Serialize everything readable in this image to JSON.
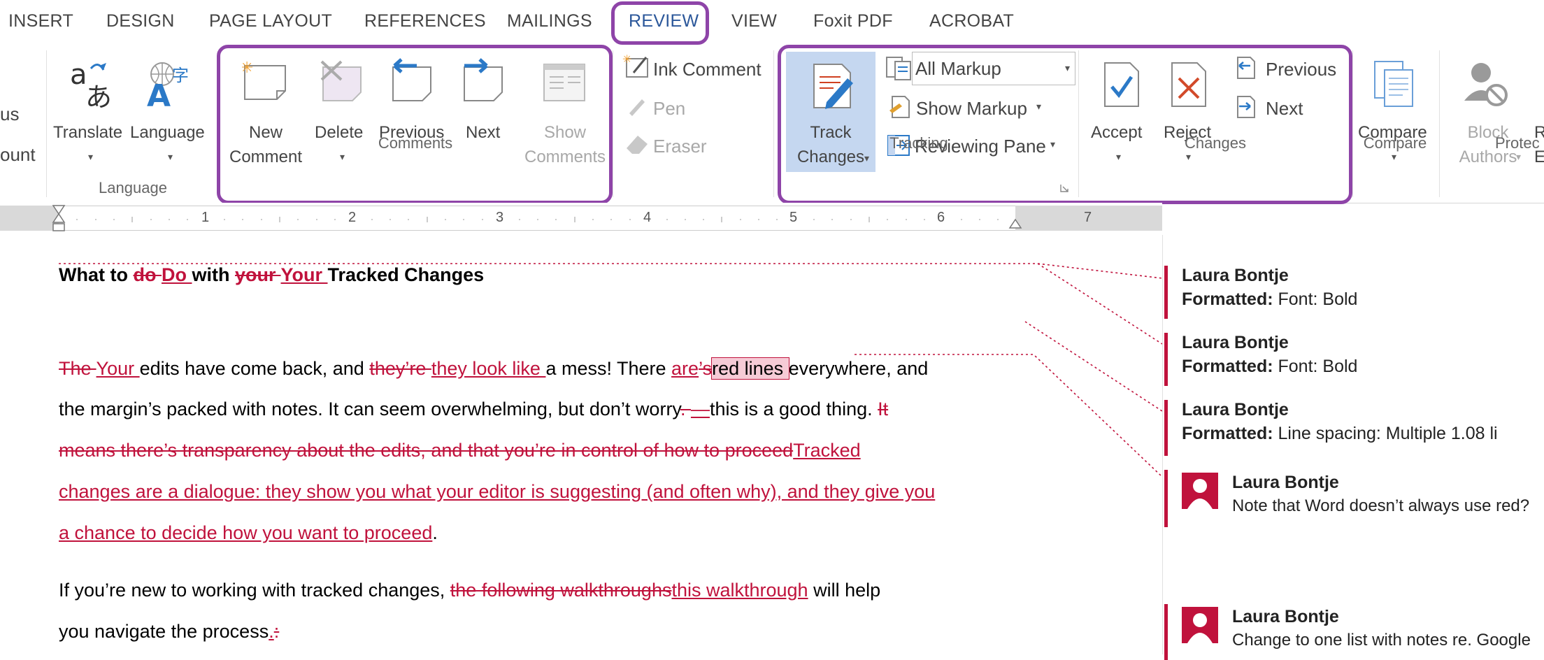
{
  "tabs": [
    {
      "label": "INSERT"
    },
    {
      "label": "DESIGN"
    },
    {
      "label": "PAGE LAYOUT"
    },
    {
      "label": "REFERENCES"
    },
    {
      "label": "MAILINGS"
    },
    {
      "label": "REVIEW",
      "active": true
    },
    {
      "label": "VIEW"
    },
    {
      "label": "Foxit PDF"
    },
    {
      "label": "ACROBAT"
    }
  ],
  "ribbon": {
    "left_partial": {
      "line1": "us",
      "line2": "ount"
    },
    "language_group": {
      "label": "Language",
      "translate": "Translate",
      "language": "Language"
    },
    "comments_group": {
      "label": "Comments",
      "new_comment": [
        "New",
        "Comment"
      ],
      "delete": "Delete",
      "previous": "Previous",
      "next": "Next",
      "show_comments": [
        "Show",
        "Comments"
      ]
    },
    "ink_group": {
      "ink_comment": "Ink Comment",
      "pen": "Pen",
      "eraser": "Eraser"
    },
    "tracking_group": {
      "label": "Tracking",
      "track_changes": [
        "Track",
        "Changes"
      ],
      "all_markup": "All Markup",
      "show_markup": "Show Markup",
      "reviewing_pane": "Reviewing Pane"
    },
    "changes_group": {
      "label": "Changes",
      "accept": "Accept",
      "reject": "Reject",
      "previous": "Previous",
      "next": "Next"
    },
    "compare_group": {
      "label": "Compare",
      "compare": "Compare"
    },
    "protect_group": {
      "label": "Protec",
      "block_authors": [
        "Block",
        "Authors"
      ],
      "restrict_partial": [
        "R",
        "E"
      ]
    }
  },
  "ruler": {
    "numbers": [
      "1",
      "2",
      "3",
      "4",
      "5",
      "6",
      "7"
    ]
  },
  "document": {
    "title": {
      "t1": "What to ",
      "d1": "do ",
      "i1": "Do ",
      "t2": "with ",
      "d2": "your ",
      "i2": "Your ",
      "t3": "Tracked Changes"
    },
    "p1_l1": {
      "d1": "The ",
      "i1": "Your ",
      "t1": "edits have come back, and ",
      "d2": "they’re ",
      "i2": "they look like ",
      "t2": "a mess! There ",
      "i3": "are",
      "d3": "’s",
      "sel": "red lines ",
      "t3": "everywhere, and"
    },
    "p1_l2": {
      "t1": "the margin’s packed with notes. It can seem overwhelming, but don’t worry",
      "d1": ". ",
      "i1": "—",
      "t2": "this is a good thing. ",
      "d2": "It"
    },
    "p1_l3": {
      "d1": "means there’s transparency about the edits, and that you’re in control of how to proceed",
      "i1": "Tracked"
    },
    "p1_l4": {
      "i1": "changes are a dialogue: they show you what your editor is suggesting (and often why), and they give you"
    },
    "p1_l5": {
      "i1": "a chance to decide how you want to proceed",
      "t1": "."
    },
    "p2_l1": {
      "t1": "If you’re new to working with tracked changes, ",
      "d1": "the following walkthroughs",
      "i1": "this walkthrough",
      "t2": " will help"
    },
    "p2_l2": {
      "t1": "you navigate the process",
      "i1": ".",
      "d1": ":"
    }
  },
  "comments": [
    {
      "author": "Laura Bontje",
      "label": "Formatted:",
      "text": " Font: Bold"
    },
    {
      "author": "Laura Bontje",
      "label": "Formatted:",
      "text": " Font: Bold"
    },
    {
      "author": "Laura Bontje",
      "label": "Formatted:",
      "text": " Line spacing:  Multiple 1.08 li"
    },
    {
      "author": "Laura Bontje",
      "text": "Note that Word doesn’t always use red?"
    },
    {
      "author": "Laura Bontje",
      "text": "Change to one list with notes re. Google"
    }
  ],
  "colors": {
    "accent": "#2b579a",
    "highlight": "#8e44a8",
    "markup": "#c0123c",
    "track_active": "#c5d7f0"
  }
}
